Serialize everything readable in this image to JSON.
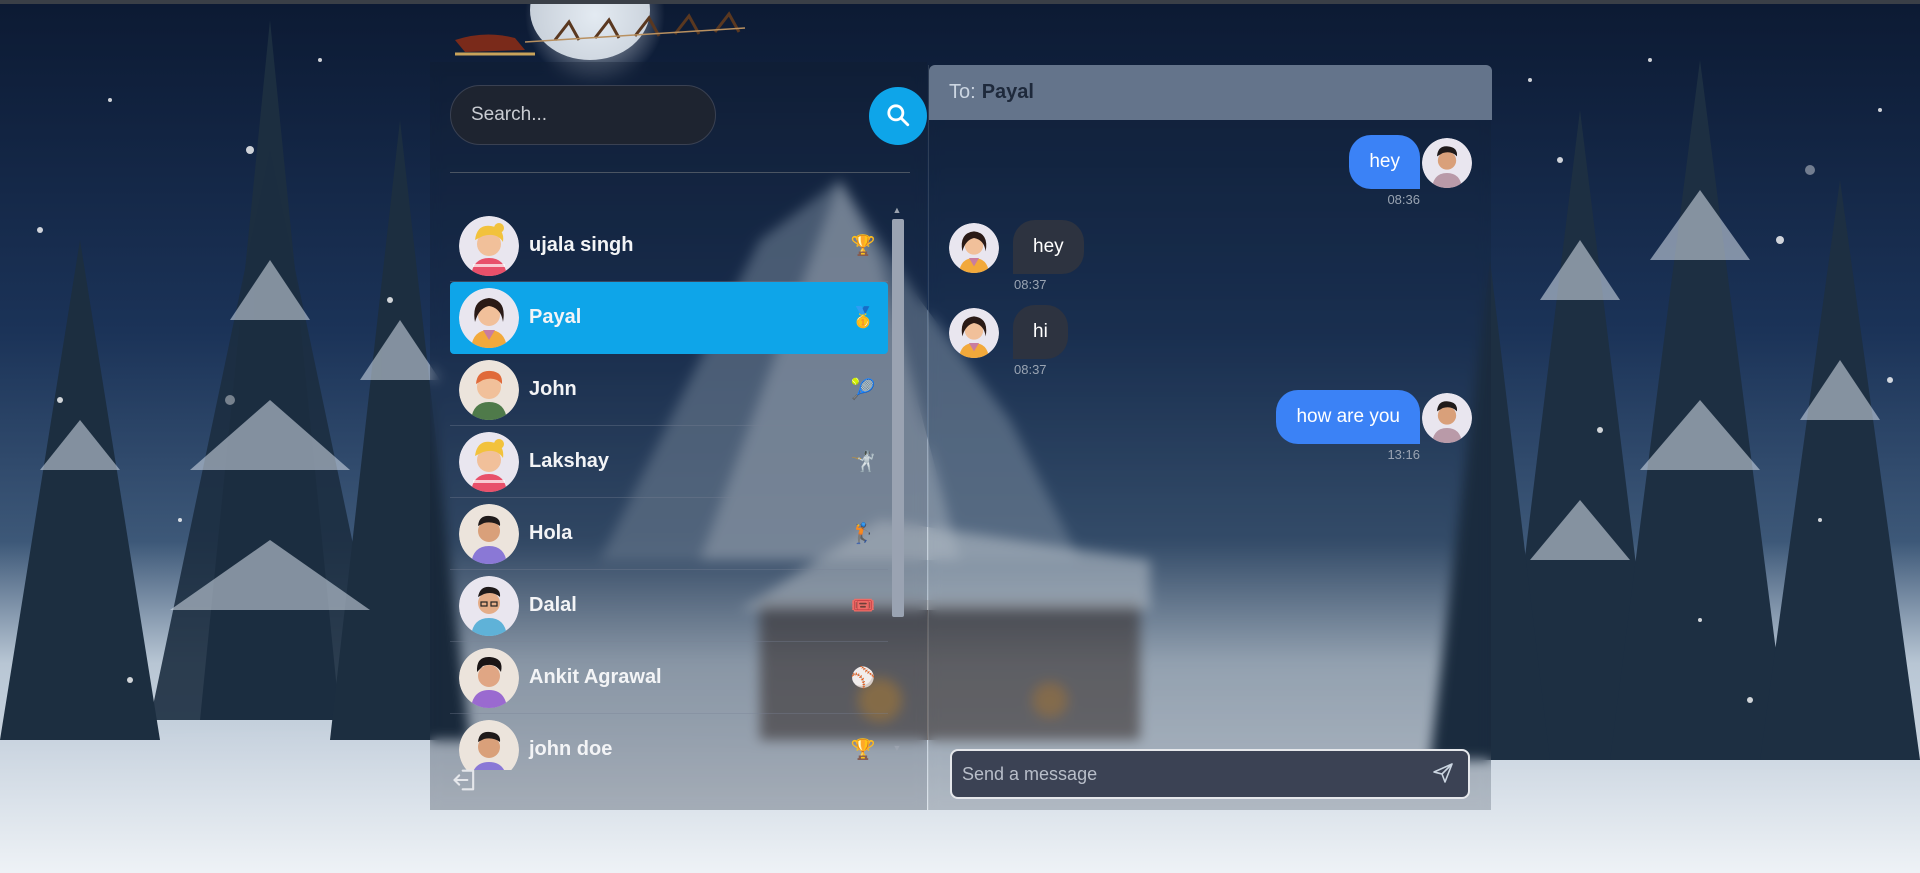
{
  "search": {
    "placeholder": "Search..."
  },
  "contacts": [
    {
      "name": "ujala singh",
      "emoji": "🏆",
      "active": false,
      "avatar": "avatar-yellow-hair"
    },
    {
      "name": "Payal",
      "emoji": "🥇",
      "active": true,
      "avatar": "avatar-dark-hair-woman"
    },
    {
      "name": "John",
      "emoji": "🎾",
      "active": false,
      "avatar": "avatar-red-hair"
    },
    {
      "name": "Lakshay",
      "emoji": "🤺",
      "active": false,
      "avatar": "avatar-yellow-hair"
    },
    {
      "name": "Hola",
      "emoji": "🏌️",
      "active": false,
      "avatar": "avatar-purple-shirt"
    },
    {
      "name": "Dalal",
      "emoji": "🎟️",
      "active": false,
      "avatar": "avatar-glasses"
    },
    {
      "name": "Ankit Agrawal",
      "emoji": "⚾",
      "active": false,
      "avatar": "avatar-curly"
    },
    {
      "name": "john doe",
      "emoji": "🏆",
      "active": false,
      "avatar": "avatar-purple-shirt"
    }
  ],
  "chat": {
    "to_label": "To:",
    "to_name": "Payal",
    "messages": [
      {
        "text": "hey",
        "time": "08:36",
        "direction": "sent"
      },
      {
        "text": "hey",
        "time": "08:37",
        "direction": "received"
      },
      {
        "text": "hi",
        "time": "08:37",
        "direction": "received"
      },
      {
        "text": "how are you",
        "time": "13:16",
        "direction": "sent"
      }
    ],
    "composer_placeholder": "Send a message"
  },
  "colors": {
    "accent": "#0ea5e9",
    "sent_bubble": "#3b82f6",
    "received_bubble": "#2d3340",
    "header": "#64748b"
  }
}
